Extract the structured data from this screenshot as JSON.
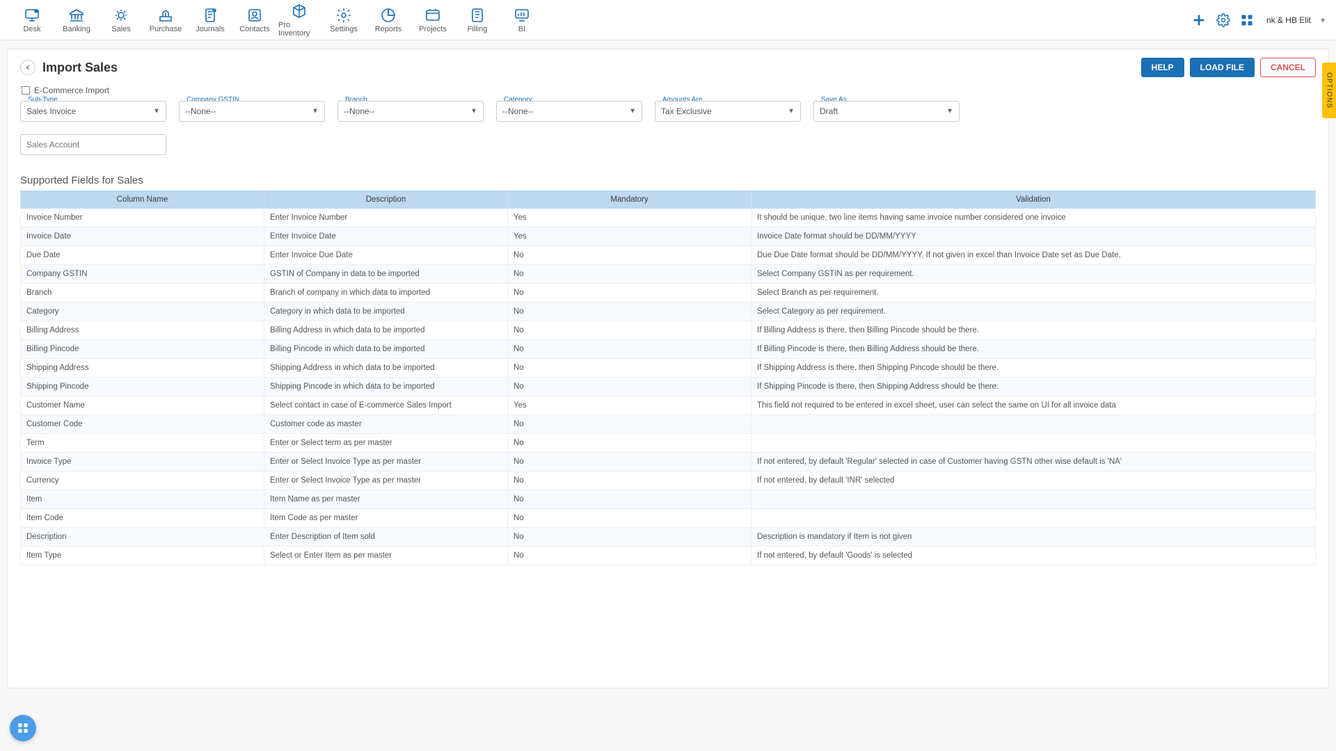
{
  "nav": {
    "items": [
      {
        "label": "Desk"
      },
      {
        "label": "Banking"
      },
      {
        "label": "Sales"
      },
      {
        "label": "Purchase"
      },
      {
        "label": "Journals"
      },
      {
        "label": "Contacts"
      },
      {
        "label": "Pro Inventory"
      },
      {
        "label": "Settings"
      },
      {
        "label": "Reports"
      },
      {
        "label": "Projects"
      },
      {
        "label": "Filling"
      },
      {
        "label": "BI"
      }
    ],
    "org_name": "nk & HB Elit"
  },
  "page": {
    "title": "Import Sales",
    "ecommerce_label": "E-Commerce Import",
    "buttons": {
      "help": "HELP",
      "load_file": "LOAD FILE",
      "cancel": "CANCEL"
    },
    "side_tab": "OPTIONS",
    "section_title": "Supported Fields for Sales"
  },
  "filters": {
    "sub_type": {
      "label": "Sub-Type",
      "value": "Sales Invoice"
    },
    "company_gstin": {
      "label": "Company GSTIN",
      "value": "--None--"
    },
    "branch": {
      "label": "Branch",
      "value": "--None--"
    },
    "category": {
      "label": "Category",
      "value": "--None--"
    },
    "amounts_are": {
      "label": "Amounts Are",
      "value": "Tax Exclusive"
    },
    "save_as": {
      "label": "Save As",
      "value": "Draft"
    },
    "sales_account": {
      "placeholder": "Sales Account"
    }
  },
  "table": {
    "headers": {
      "col": "Column Name",
      "desc": "Description",
      "mand": "Mandatory",
      "valid": "Validation"
    },
    "rows": [
      {
        "c": "Invoice Number",
        "d": "Enter Invoice Number",
        "m": "Yes",
        "v": "It should be unique, two line items having same invoice number considered one invoice"
      },
      {
        "c": "Invoice Date",
        "d": "Enter Invoice Date",
        "m": "Yes",
        "v": "Invoice Date format should be DD/MM/YYYY"
      },
      {
        "c": "Due Date",
        "d": "Enter Invoice Due Date",
        "m": "No",
        "v": "Due Due Date format should be DD/MM/YYYY, If not given in excel than Invoice Date set as Due Date."
      },
      {
        "c": "Company GSTIN",
        "d": "GSTIN of Company in data to be imported",
        "m": "No",
        "v": "Select Company GSTIN as per requirement."
      },
      {
        "c": "Branch",
        "d": "Branch of company in which data to imported",
        "m": "No",
        "v": "Select Branch as per requirement."
      },
      {
        "c": "Category",
        "d": "Category in which data to be imported",
        "m": "No",
        "v": "Select Category as per requirement."
      },
      {
        "c": "Billing Address",
        "d": "Billing Address in which data to be imported",
        "m": "No",
        "v": "If Billing Address is there, then Billing Pincode should be there."
      },
      {
        "c": "Billing Pincode",
        "d": "Billing Pincode in which data to be imported",
        "m": "No",
        "v": "If Billing Pincode is there, then Billing Address should be there."
      },
      {
        "c": "Shipping Address",
        "d": "Shipping Address in which data to be imported",
        "m": "No",
        "v": "If Shipping Address is there, then Shipping Pincode should be there."
      },
      {
        "c": "Shipping Pincode",
        "d": "Shipping Pincode in which data to be imported",
        "m": "No",
        "v": "If Shipping Pincode is there, then Shipping Address should be there."
      },
      {
        "c": "Customer Name",
        "d": "Select contact in case of E-commerce Sales Import",
        "m": "Yes",
        "v": "This field not required to be entered in excel sheet, user can select the same on UI for all invoice data"
      },
      {
        "c": "Customer Code",
        "d": "Customer code as master",
        "m": "No",
        "v": ""
      },
      {
        "c": "Term",
        "d": "Enter or Select term as per master",
        "m": "No",
        "v": ""
      },
      {
        "c": "Invoice Type",
        "d": "Enter or Select Invoice Type as per master",
        "m": "No",
        "v": "If not entered, by default 'Regular' selected in case of Customer having GSTN other wise default is 'NA'"
      },
      {
        "c": "Currency",
        "d": "Enter or Select Invoice Type as per master",
        "m": "No",
        "v": "If not entered, by default 'INR' selected"
      },
      {
        "c": "Item",
        "d": "Item Name as per master",
        "m": "No",
        "v": ""
      },
      {
        "c": "Item Code",
        "d": "Item Code as per master",
        "m": "No",
        "v": ""
      },
      {
        "c": "Description",
        "d": "Enter Description of Item sold",
        "m": "No",
        "v": "Description is mandatory if Item is not given"
      },
      {
        "c": "Item Type",
        "d": "Select or Enter Item as per master",
        "m": "No",
        "v": "If not entered, by default 'Goods' is selected"
      }
    ]
  }
}
